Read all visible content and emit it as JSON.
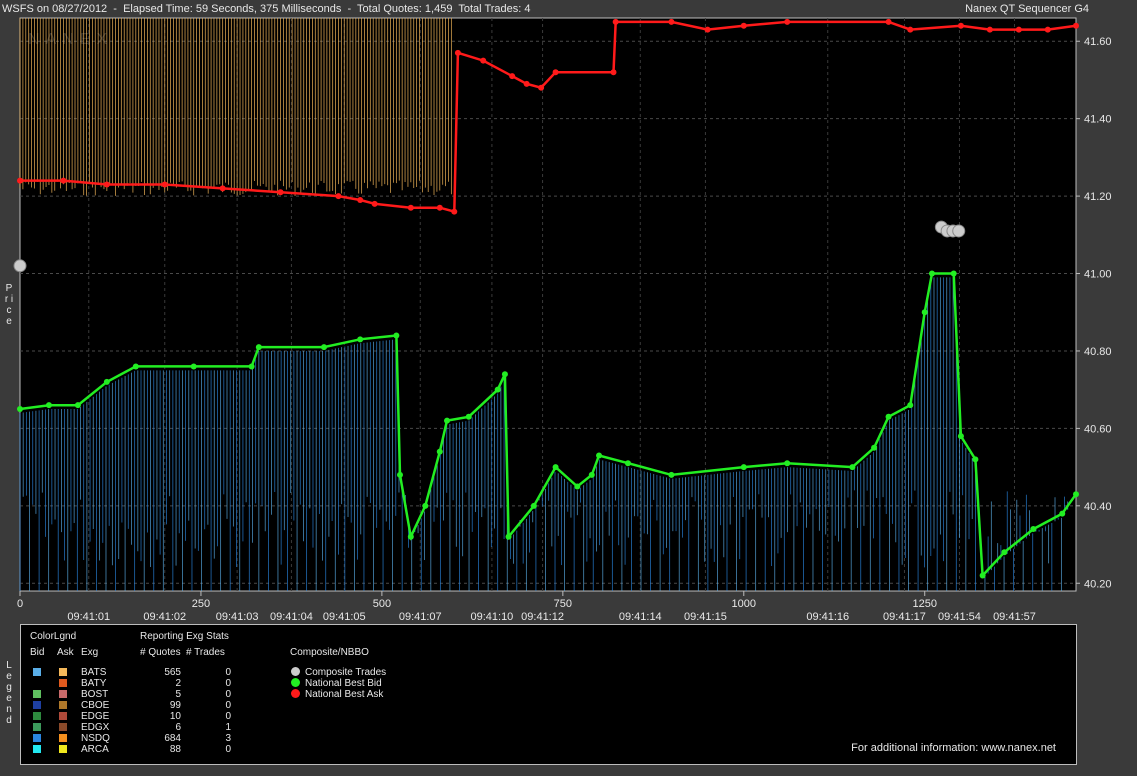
{
  "header": {
    "title_left": "WSFS on 08/27/2012  -  Elapsed Time: 59 Seconds, 375 Milliseconds  -  Total Quotes: 1,459  Total Trades: 4",
    "title_right": "Nanex QT Sequencer G4",
    "watermark": "NANEX"
  },
  "y_axis_title": "P r i c e",
  "legend_side_title": "L e g e n d",
  "chart_data": {
    "type": "line",
    "ylim": [
      40.18,
      41.66
    ],
    "y_ticks": [
      {
        "value": 41.6,
        "label": "41.60"
      },
      {
        "value": 41.4,
        "label": "41.40"
      },
      {
        "value": 41.2,
        "label": "41.20"
      },
      {
        "value": 41.0,
        "label": "41.00"
      },
      {
        "value": 40.8,
        "label": "40.80"
      },
      {
        "value": 40.6,
        "label": "40.60"
      },
      {
        "value": 40.4,
        "label": "40.40"
      },
      {
        "value": 40.2,
        "label": "40.20"
      }
    ],
    "xlim": [
      0,
      1459
    ],
    "x_ticks": [
      {
        "value": 0,
        "label": "0"
      },
      {
        "value": 250,
        "label": "250"
      },
      {
        "value": 500,
        "label": "500"
      },
      {
        "value": 750,
        "label": "750"
      },
      {
        "value": 1000,
        "label": "1000"
      },
      {
        "value": 1250,
        "label": "1250"
      }
    ],
    "time_labels": [
      {
        "value": 95,
        "label": "09:41:01"
      },
      {
        "value": 200,
        "label": "09:41:02"
      },
      {
        "value": 300,
        "label": "09:41:03"
      },
      {
        "value": 375,
        "label": "09:41:04"
      },
      {
        "value": 448,
        "label": "09:41:05"
      },
      {
        "value": 553,
        "label": "09:41:07"
      },
      {
        "value": 652,
        "label": "09:41:10"
      },
      {
        "value": 722,
        "label": "09:41:12"
      },
      {
        "value": 857,
        "label": "09:41:14"
      },
      {
        "value": 947,
        "label": "09:41:15"
      },
      {
        "value": 1116,
        "label": "09:41:16"
      },
      {
        "value": 1222,
        "label": "09:41:17"
      },
      {
        "value": 1298,
        "label": "09:41:54"
      },
      {
        "value": 1374,
        "label": "09:41:57"
      }
    ],
    "series": [
      {
        "name": "National Best Ask",
        "color": "#ff1a1a",
        "points": [
          [
            0,
            41.24
          ],
          [
            60,
            41.24
          ],
          [
            120,
            41.23
          ],
          [
            200,
            41.23
          ],
          [
            280,
            41.22
          ],
          [
            360,
            41.21
          ],
          [
            440,
            41.2
          ],
          [
            470,
            41.19
          ],
          [
            490,
            41.18
          ],
          [
            540,
            41.17
          ],
          [
            580,
            41.17
          ],
          [
            600,
            41.16
          ],
          [
            605,
            41.57
          ],
          [
            640,
            41.55
          ],
          [
            680,
            41.51
          ],
          [
            700,
            41.49
          ],
          [
            720,
            41.48
          ],
          [
            740,
            41.52
          ],
          [
            820,
            41.52
          ],
          [
            823,
            41.65
          ],
          [
            900,
            41.65
          ],
          [
            950,
            41.63
          ],
          [
            1000,
            41.64
          ],
          [
            1060,
            41.65
          ],
          [
            1200,
            41.65
          ],
          [
            1230,
            41.63
          ],
          [
            1300,
            41.64
          ],
          [
            1340,
            41.63
          ],
          [
            1380,
            41.63
          ],
          [
            1420,
            41.63
          ],
          [
            1459,
            41.64
          ]
        ]
      },
      {
        "name": "National Best Bid",
        "color": "#22ee22",
        "points": [
          [
            0,
            40.65
          ],
          [
            40,
            40.66
          ],
          [
            80,
            40.66
          ],
          [
            120,
            40.72
          ],
          [
            160,
            40.76
          ],
          [
            240,
            40.76
          ],
          [
            320,
            40.76
          ],
          [
            330,
            40.81
          ],
          [
            420,
            40.81
          ],
          [
            470,
            40.83
          ],
          [
            520,
            40.84
          ],
          [
            525,
            40.48
          ],
          [
            540,
            40.32
          ],
          [
            560,
            40.4
          ],
          [
            580,
            40.54
          ],
          [
            590,
            40.62
          ],
          [
            620,
            40.63
          ],
          [
            660,
            40.7
          ],
          [
            670,
            40.74
          ],
          [
            675,
            40.32
          ],
          [
            710,
            40.4
          ],
          [
            740,
            40.5
          ],
          [
            770,
            40.45
          ],
          [
            790,
            40.48
          ],
          [
            800,
            40.53
          ],
          [
            840,
            40.51
          ],
          [
            900,
            40.48
          ],
          [
            1000,
            40.5
          ],
          [
            1060,
            40.51
          ],
          [
            1150,
            40.5
          ],
          [
            1180,
            40.55
          ],
          [
            1200,
            40.63
          ],
          [
            1230,
            40.66
          ],
          [
            1250,
            40.9
          ],
          [
            1260,
            41.0
          ],
          [
            1290,
            41.0
          ],
          [
            1300,
            40.58
          ],
          [
            1320,
            40.52
          ],
          [
            1330,
            40.22
          ],
          [
            1360,
            40.28
          ],
          [
            1400,
            40.34
          ],
          [
            1440,
            40.38
          ],
          [
            1459,
            40.43
          ]
        ]
      },
      {
        "name": "Composite Trades",
        "color": "#cccccc",
        "points": [
          [
            0,
            41.02
          ],
          [
            1273,
            41.12
          ],
          [
            1281,
            41.11
          ],
          [
            1289,
            41.11
          ],
          [
            1297,
            41.11
          ]
        ]
      }
    ]
  },
  "legend": {
    "color_legend_title": "ColorLgnd",
    "col_bid": "Bid",
    "col_ask": "Ask",
    "col_exg": "Exg",
    "stats_title": "Reporting Exg Stats",
    "col_quotes": "# Quotes",
    "col_trades": "# Trades",
    "composite_title": "Composite/NBBO",
    "exchanges": [
      {
        "name": "BATS",
        "bid_color": "#5aaee8",
        "ask_color": "#f5b85a",
        "quotes": "565",
        "trades": "0"
      },
      {
        "name": "BATY",
        "bid_color": "#000000",
        "ask_color": "#e05a1e",
        "quotes": "2",
        "trades": "0"
      },
      {
        "name": "BOST",
        "bid_color": "#5fbf5f",
        "ask_color": "#c96a6a",
        "quotes": "5",
        "trades": "0"
      },
      {
        "name": "CBOE",
        "bid_color": "#1e3fa0",
        "ask_color": "#b0782a",
        "quotes": "99",
        "trades": "0"
      },
      {
        "name": "EDGE",
        "bid_color": "#2e8a3e",
        "ask_color": "#b04a3a",
        "quotes": "10",
        "trades": "0"
      },
      {
        "name": "EDGX",
        "bid_color": "#3c9a5c",
        "ask_color": "#8a4a2a",
        "quotes": "6",
        "trades": "1"
      },
      {
        "name": "NSDQ",
        "bid_color": "#2a86e0",
        "ask_color": "#f5901e",
        "quotes": "684",
        "trades": "3"
      },
      {
        "name": "ARCA",
        "bid_color": "#22e8f0",
        "ask_color": "#f0e81e",
        "quotes": "88",
        "trades": "0"
      }
    ],
    "composite_items": [
      {
        "label": "Composite Trades",
        "color": "#cccccc"
      },
      {
        "label": "National Best Bid",
        "color": "#22ee22"
      },
      {
        "label": "National Best Ask",
        "color": "#ff1a1a"
      }
    ]
  },
  "footer_text": "For additional information: www.nanex.net"
}
